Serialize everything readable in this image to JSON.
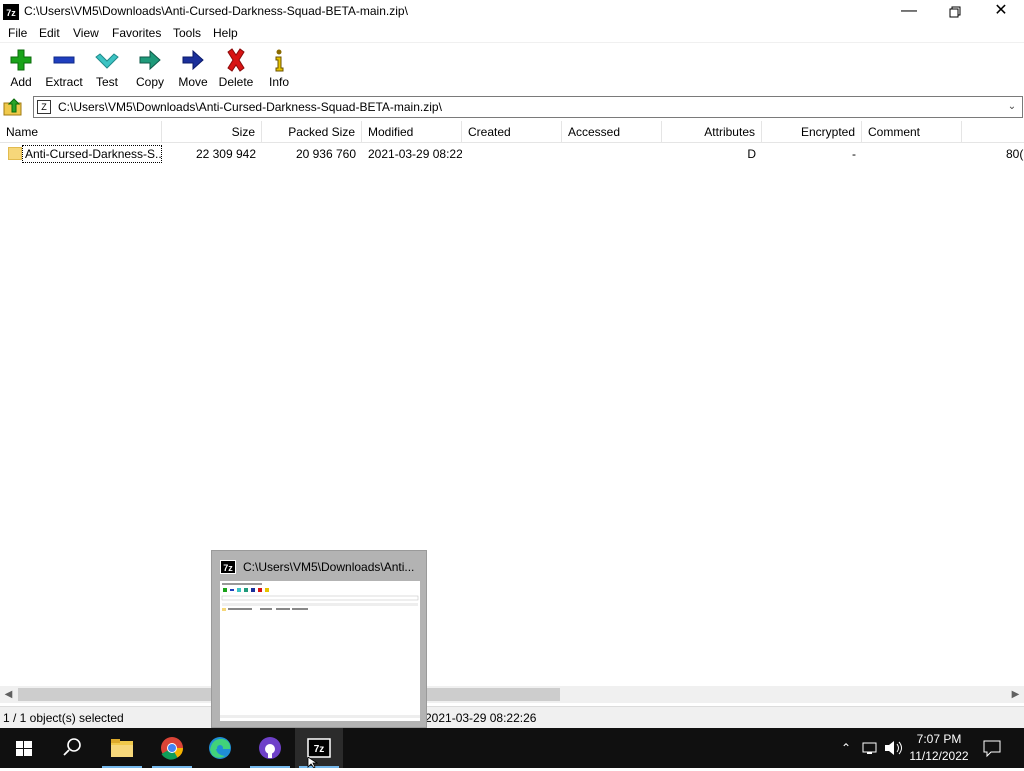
{
  "window": {
    "app_icon": "7z",
    "title": "C:\\Users\\VM5\\Downloads\\Anti-Cursed-Darkness-Squad-BETA-main.zip\\",
    "controls": [
      "minimize",
      "maximize",
      "close"
    ]
  },
  "menu": [
    "File",
    "Edit",
    "View",
    "Favorites",
    "Tools",
    "Help"
  ],
  "toolbar": [
    {
      "label": "Add",
      "icon": "plus-icon"
    },
    {
      "label": "Extract",
      "icon": "minus-icon"
    },
    {
      "label": "Test",
      "icon": "check-icon"
    },
    {
      "label": "Copy",
      "icon": "copy-arrow-icon"
    },
    {
      "label": "Move",
      "icon": "move-arrow-icon"
    },
    {
      "label": "Delete",
      "icon": "delete-x-icon"
    },
    {
      "label": "Info",
      "icon": "info-icon"
    }
  ],
  "address": {
    "path": "C:\\Users\\VM5\\Downloads\\Anti-Cursed-Darkness-Squad-BETA-main.zip\\"
  },
  "columns": [
    "Name",
    "Size",
    "Packed Size",
    "Modified",
    "Created",
    "Accessed",
    "Attributes",
    "Encrypted",
    "Comment"
  ],
  "rows": [
    {
      "name": "Anti-Cursed-Darkness-S...",
      "size": "22 309 942",
      "packed_size": "20 936 760",
      "modified": "2021-03-29 08:22",
      "created": "",
      "accessed": "",
      "attributes": "D",
      "encrypted": "-",
      "comment": "",
      "overflow": "80("
    }
  ],
  "status": {
    "selection": "1 / 1 object(s) selected",
    "date": "2021-03-29 08:22:26"
  },
  "thumbnail": {
    "title": "C:\\Users\\VM5\\Downloads\\Anti..."
  },
  "taskbar": {
    "apps": [
      "start-icon",
      "search-icon",
      "file-explorer-icon",
      "chrome-icon",
      "edge-icon",
      "github-desktop-icon",
      "7zip-icon"
    ],
    "clock_time": "7:07 PM",
    "clock_date": "11/12/2022"
  },
  "colors": {
    "taskbar_bg": "#101010",
    "accent_underline": "#76b9ed",
    "folder": "#f6d77a"
  }
}
